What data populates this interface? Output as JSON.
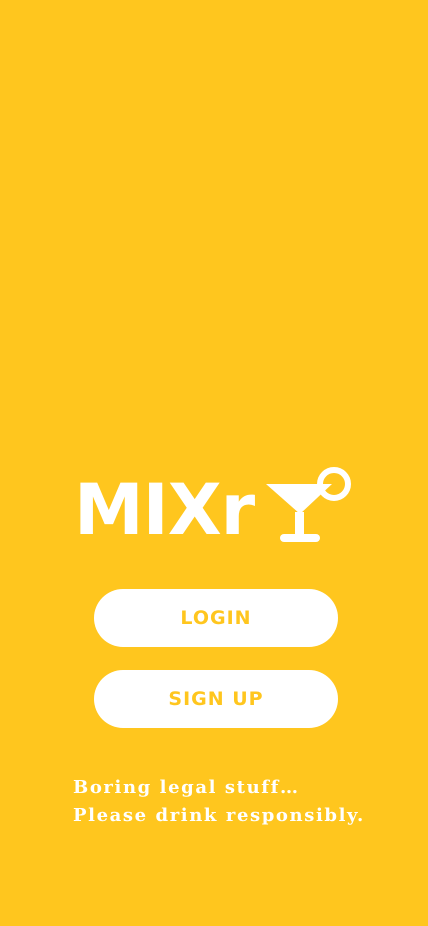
{
  "app": {
    "logo_text": "MIXr",
    "logo_icon": "cocktail-glass-icon"
  },
  "auth": {
    "login_label": "LOGIN",
    "signup_label": "SIGN UP"
  },
  "footer": {
    "legal_text": "Boring legal stuff… Please drink responsibly."
  },
  "colors": {
    "background": "#FFC61E",
    "button_bg": "#FFFFFF",
    "button_text": "#FFC61E",
    "text_light": "#FFFFFF"
  }
}
